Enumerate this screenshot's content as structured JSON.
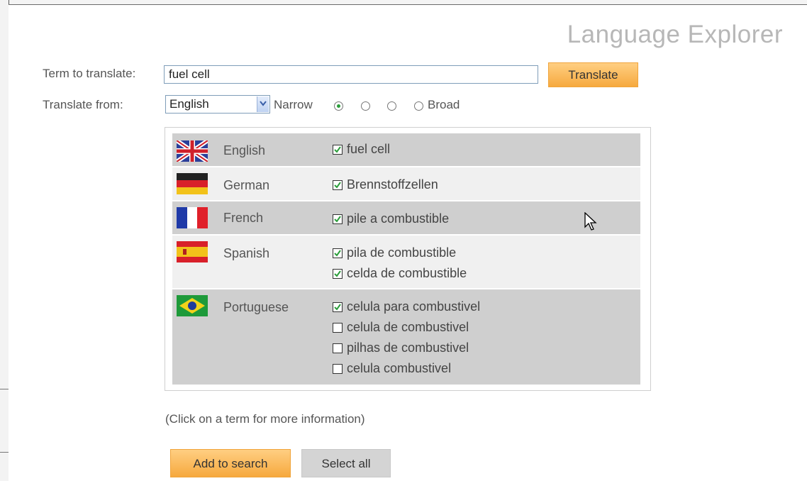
{
  "app": {
    "title": "Language Explorer"
  },
  "form": {
    "term_label": "Term to translate:",
    "term_value": "fuel cell",
    "translate_button": "Translate",
    "from_label": "Translate from:",
    "from_value": "English",
    "narrow_label": "Narrow",
    "broad_label": "Broad",
    "scope_selected_index": 0,
    "scope_count": 4
  },
  "results": [
    {
      "language": "English",
      "flag": "uk-flag-icon",
      "terms": [
        {
          "text": "fuel cell",
          "checked": true
        }
      ]
    },
    {
      "language": "German",
      "flag": "germany-flag-icon",
      "terms": [
        {
          "text": "Brennstoffzellen",
          "checked": true
        }
      ]
    },
    {
      "language": "French",
      "flag": "france-flag-icon",
      "terms": [
        {
          "text": "pile a combustible",
          "checked": true
        }
      ]
    },
    {
      "language": "Spanish",
      "flag": "spain-flag-icon",
      "terms": [
        {
          "text": "pila de combustible",
          "checked": true
        },
        {
          "text": "celda de combustible",
          "checked": true
        }
      ]
    },
    {
      "language": "Portuguese",
      "flag": "brazil-flag-icon",
      "terms": [
        {
          "text": "celula para combustivel",
          "checked": true
        },
        {
          "text": "celula de combustivel",
          "checked": false
        },
        {
          "text": "pilhas de combustivel",
          "checked": false
        },
        {
          "text": "celula combustivel",
          "checked": false
        }
      ]
    }
  ],
  "hint": "(Click on a term for more information)",
  "actions": {
    "add_to_search": "Add to search",
    "select_all": "Select all"
  },
  "colors": {
    "accent": "#f6a93e",
    "row_dark": "#cfcfcf",
    "row_light": "#f0f0f0",
    "title": "#b7b7b7"
  }
}
